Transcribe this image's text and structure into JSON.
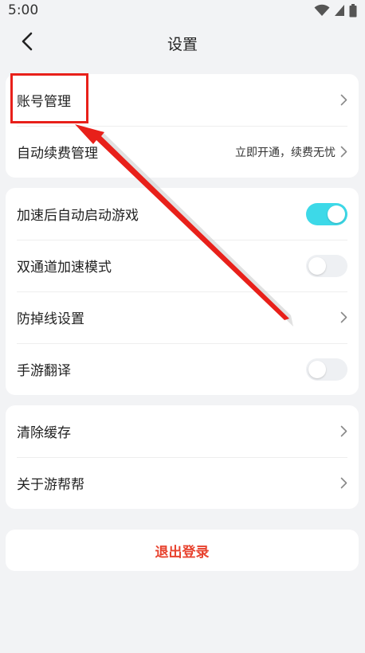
{
  "status_bar": {
    "time": "5:00"
  },
  "header": {
    "title": "设置"
  },
  "account_card": {
    "account_management": "账号管理",
    "auto_renew": "自动续费管理",
    "auto_renew_value": "立即开通，续费无忧"
  },
  "game_card": {
    "auto_launch": "加速后自动启动游戏",
    "auto_launch_on": true,
    "dual_channel": "双通道加速模式",
    "dual_channel_on": false,
    "anti_disconnect": "防掉线设置",
    "mobile_translate": "手游翻译",
    "mobile_translate_on": false
  },
  "misc_card": {
    "clear_cache": "清除缓存",
    "about": "关于游帮帮"
  },
  "logout": {
    "label": "退出登录"
  },
  "colors": {
    "toggle_on": "#3dd9e8",
    "logout_text": "#e8432f",
    "annotation": "#e8201a"
  }
}
